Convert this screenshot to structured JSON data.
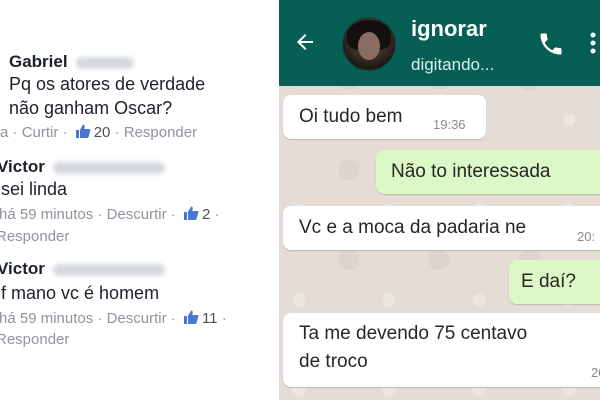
{
  "facebook": {
    "comments": [
      {
        "name": "Gabriel",
        "text_lines": [
          "Pq os atores de verdade",
          "não ganham Oscar?"
        ],
        "time": "a",
        "like_label": "Curtir",
        "like_count": "20",
        "reply_label": "Responder"
      },
      {
        "name": "Victor",
        "text_lines": [
          "sei linda"
        ],
        "time": "há 59 minutos",
        "like_label": "Descurtir",
        "like_count": "2",
        "reply_label": "Responder"
      },
      {
        "name": "Victor",
        "text_lines": [
          "f mano vc é homem"
        ],
        "time": "há 59 minutos",
        "like_label": "Descurtir",
        "like_count": "11",
        "reply_label": "Responder"
      }
    ],
    "separator": "·"
  },
  "whatsapp": {
    "contact_name": "ignorar",
    "status": "digitando...",
    "colors": {
      "header": "#075e54",
      "incoming": "#ffffff",
      "outgoing": "#dcf8c6",
      "wallpaper": "#e5ddd5"
    },
    "icons": {
      "back": "back-arrow-icon",
      "call": "phone-icon",
      "menu": "more-vertical-icon"
    },
    "messages": [
      {
        "direction": "in",
        "text": "Oi tudo bem",
        "time": "19:36"
      },
      {
        "direction": "out",
        "text": "Não to interessada",
        "time": ""
      },
      {
        "direction": "in",
        "text": "Vc e a moca da padaria ne",
        "time": "20:"
      },
      {
        "direction": "out",
        "text": "E daí?",
        "time": ""
      },
      {
        "direction": "in",
        "text_lines": [
          "Ta me devendo 75 centavo",
          "de troco"
        ],
        "time": "20"
      }
    ]
  }
}
